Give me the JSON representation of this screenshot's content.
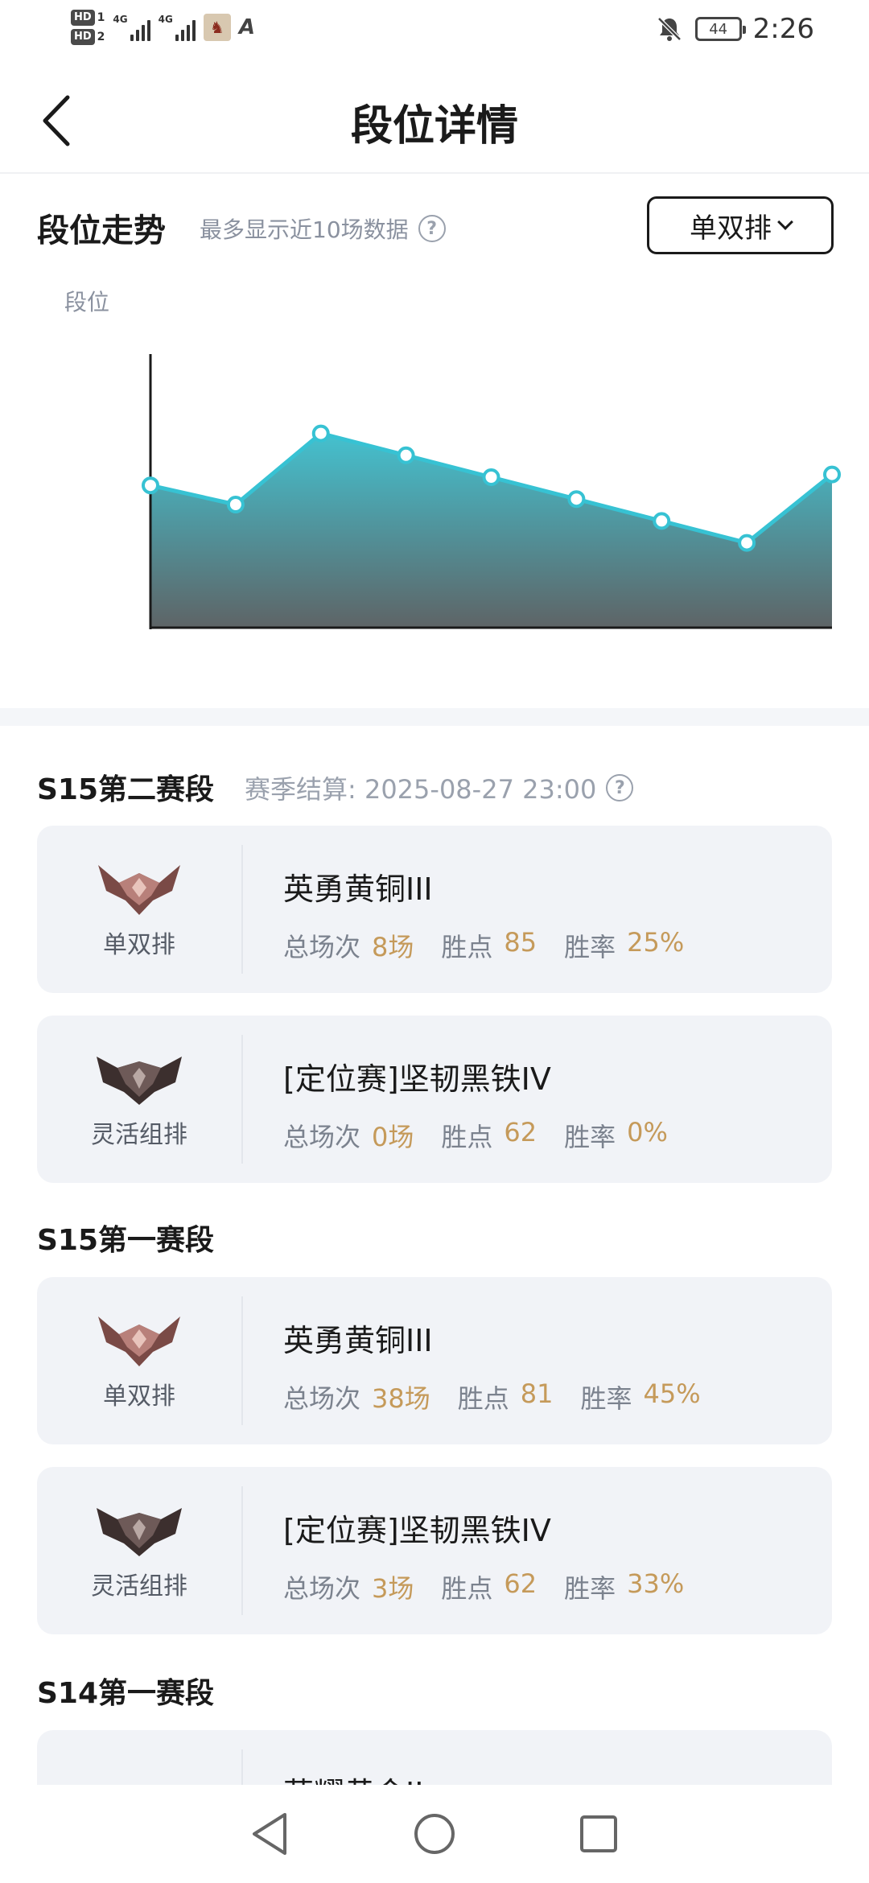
{
  "status_bar": {
    "hd1": "HD",
    "hd1_num": "1",
    "hd2": "HD",
    "hd2_num": "2",
    "signal1_label": "4G",
    "signal2_label": "4G",
    "battery": "44",
    "time": "2:26"
  },
  "header": {
    "title": "段位详情"
  },
  "trend": {
    "title": "段位走势",
    "subtitle": "最多显示近10场数据",
    "queue_selector": "单双排",
    "y_label": "段位"
  },
  "chart_data": {
    "type": "area",
    "title": "",
    "xlabel": "",
    "ylabel": "段位",
    "grid": false,
    "series": [
      {
        "values": [
          0.52,
          0.45,
          0.71,
          0.63,
          0.55,
          0.47,
          0.39,
          0.31,
          0.56
        ]
      }
    ],
    "colors": {
      "line": "#37c2d3",
      "fill_top": "#44c1cf",
      "fill_bottom": "#5e6466"
    }
  },
  "seasons": [
    {
      "title": "S15第二赛段",
      "meta": "赛季结算: 2025-08-27 23:00",
      "cards": [
        {
          "queue": "单双排",
          "rank": "英勇黄铜III",
          "games_label": "总场次",
          "games": "8场",
          "lp_label": "胜点",
          "lp": "85",
          "wr_label": "胜率",
          "wr": "25%",
          "emblem": "bronze"
        },
        {
          "queue": "灵活组排",
          "rank": "[定位赛]坚韧黑铁IV",
          "games_label": "总场次",
          "games": "0场",
          "lp_label": "胜点",
          "lp": "62",
          "wr_label": "胜率",
          "wr": "0%",
          "emblem": "iron"
        }
      ]
    },
    {
      "title": "S15第一赛段",
      "meta": "",
      "cards": [
        {
          "queue": "单双排",
          "rank": "英勇黄铜III",
          "games_label": "总场次",
          "games": "38场",
          "lp_label": "胜点",
          "lp": "81",
          "wr_label": "胜率",
          "wr": "45%",
          "emblem": "bronze"
        },
        {
          "queue": "灵活组排",
          "rank": "[定位赛]坚韧黑铁IV",
          "games_label": "总场次",
          "games": "3场",
          "lp_label": "胜点",
          "lp": "62",
          "wr_label": "胜率",
          "wr": "33%",
          "emblem": "iron"
        }
      ]
    },
    {
      "title": "S14第一赛段",
      "meta": "",
      "cards": [
        {
          "rank": "荣耀黄金II",
          "emblem": "gold"
        }
      ]
    }
  ],
  "icons": {
    "back": "chevron-left-icon",
    "help": "question-circle-icon",
    "dropdown": "chevron-down-icon",
    "bell": "bell-off-icon",
    "nav_back": "triangle-back-icon",
    "nav_home": "circle-home-icon",
    "nav_recent": "square-recent-icon"
  }
}
